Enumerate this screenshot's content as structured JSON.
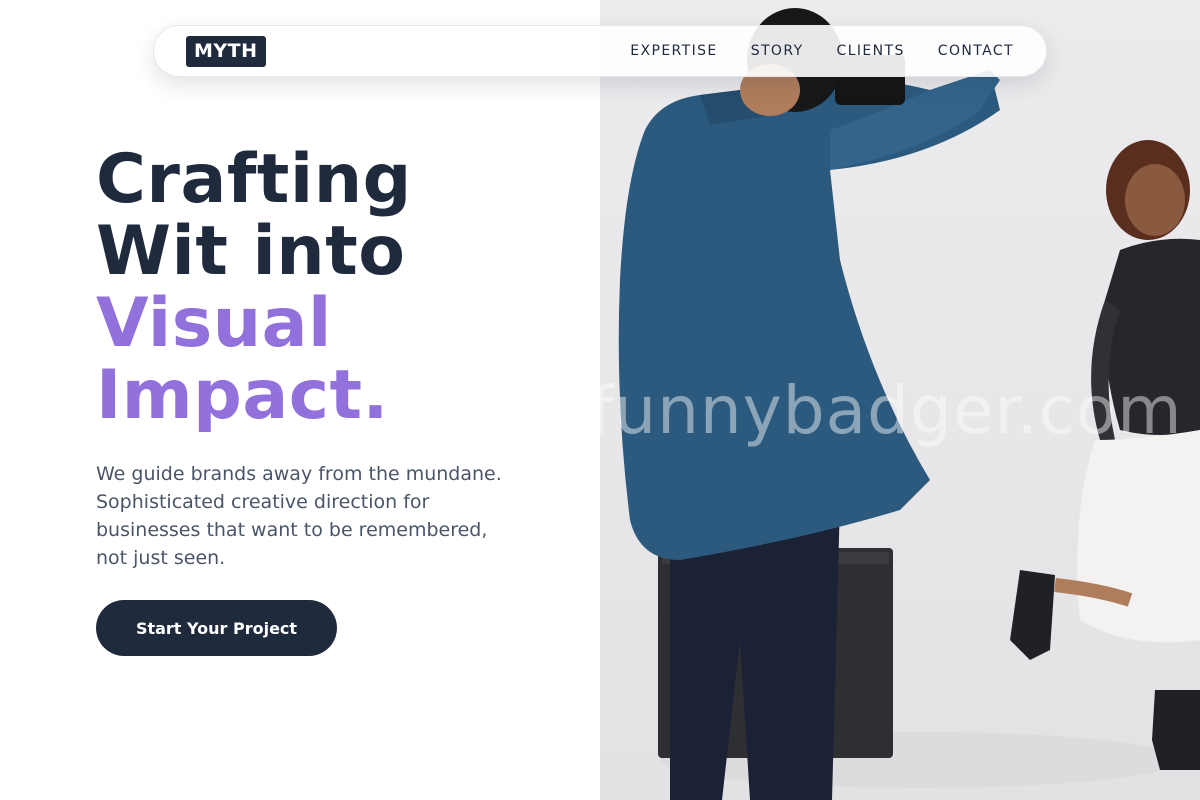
{
  "nav": {
    "logo": "MYTH",
    "links": [
      "EXPERTISE",
      "STORY",
      "CLIENTS",
      "CONTACT"
    ]
  },
  "hero": {
    "line1": "Crafting",
    "line2": "Wit into",
    "line3": "Visual",
    "line4": "Impact.",
    "subtitle": "We guide brands away from the mundane. Sophisticated creative direction for businesses that want to be remembered, not just seen.",
    "cta": "Start Your Project"
  },
  "photo": {
    "watermark": "funnybadger.com",
    "description_icon": "photographer-and-model-photo"
  },
  "colors": {
    "navy": "#1f2a3d",
    "accent_purple": "#9271dc",
    "body_text": "#4a5568"
  }
}
